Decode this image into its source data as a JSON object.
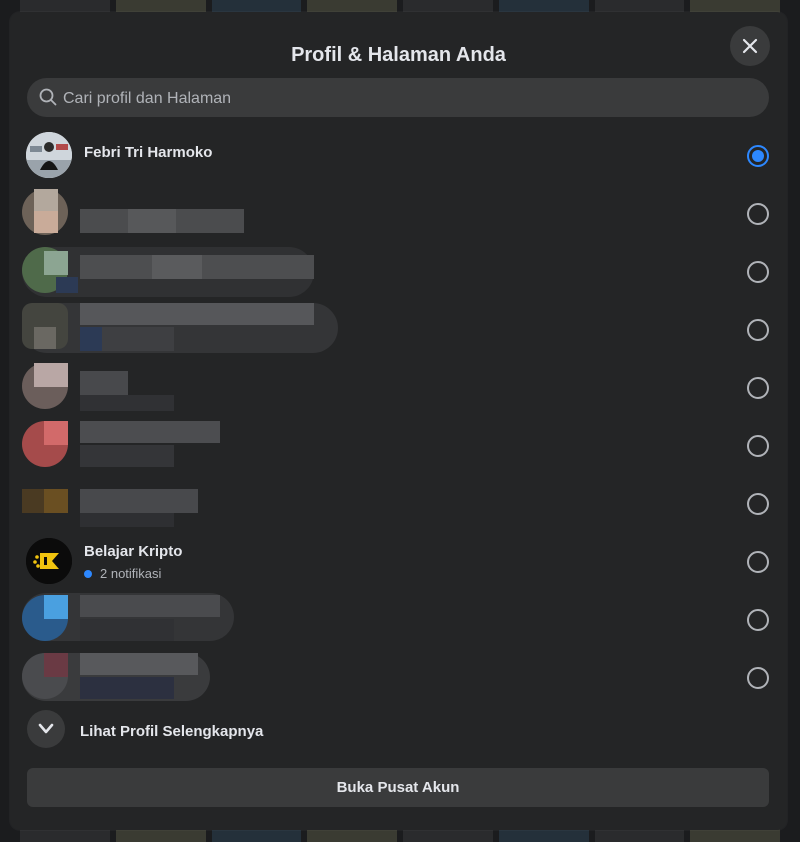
{
  "dialog": {
    "title": "Profil & Halaman Anda",
    "close_icon": "close-icon",
    "search": {
      "placeholder": "Cari profil dan Halaman",
      "value": ""
    },
    "profiles": [
      {
        "name": "Febri Tri Harmoko",
        "selected": true
      },
      {
        "name": "",
        "redacted": true,
        "selected": false
      },
      {
        "name": "",
        "redacted": true,
        "selected": false
      },
      {
        "name": "",
        "redacted": true,
        "selected": false
      },
      {
        "name": "",
        "redacted": true,
        "selected": false
      },
      {
        "name": "",
        "redacted": true,
        "selected": false
      },
      {
        "name": "",
        "redacted": true,
        "selected": false
      },
      {
        "name": "Belajar Kripto",
        "notification": "2 notifikasi",
        "selected": false
      },
      {
        "name": "",
        "redacted": true,
        "selected": false
      },
      {
        "name": "",
        "redacted": true,
        "selected": false
      }
    ],
    "see_more_label": "Lihat Profil Selengkapnya",
    "account_center_label": "Buka Pusat Akun"
  },
  "colors": {
    "background": "#242526",
    "surface": "#3a3b3c",
    "accent": "#2d88ff",
    "text_primary": "#e4e6eb",
    "text_secondary": "#b0b3b8"
  }
}
